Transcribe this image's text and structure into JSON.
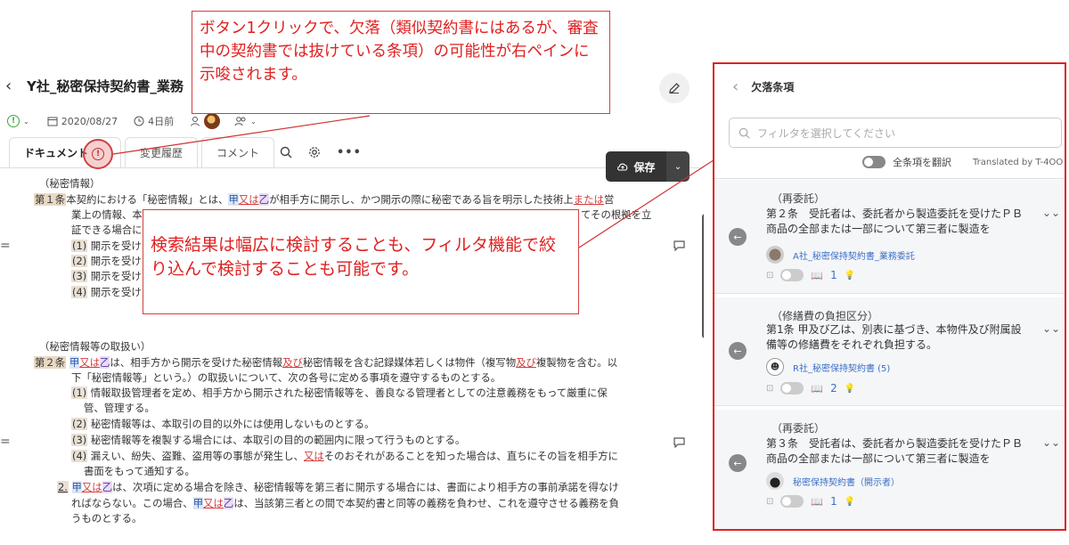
{
  "left": {
    "title": "Y社_秘密保持契約書_業務",
    "date": "2020/08/27",
    "relative_time": "4日前",
    "tabs": [
      "ドキュメント",
      "変更履歴",
      "コメント"
    ],
    "save_label": "保存",
    "doc_lines": {
      "h1": "（秘密情報）",
      "a1_num": "第１条",
      "a1_pre": "本契約における「秘密情報」とは、",
      "a1_kou": "甲",
      "a1_mata": "又は",
      "a1_otsu": "乙",
      "a1_post": "が相手方に開示し、かつ開示の際に秘密である旨を明示した技術上",
      "a1_mata2": "または",
      "a1_tail": "営",
      "a1_l2a": "業上の情報、本",
      "a1_l2b": "てその根拠を立",
      "a1_l3": "証できる場合に",
      "i1": "(1)",
      "i1_t": "開示を受け",
      "i2": "(2)",
      "i2_t": "開示を受け",
      "i3": "(3)",
      "i3_t": "開示を受け",
      "i4": "(4)",
      "i4_t": "開示を受け",
      "h2": "（秘密情報等の取扱い）",
      "a2_num": "第２条",
      "a2_kou": "甲",
      "a2_mata": "又は",
      "a2_otsu": "乙",
      "a2_mid": "は、相手方から開示を受けた秘密情報",
      "a2_oyobi": "及び",
      "a2_mid2": "秘密情報を含む記録媒体若しくは物件（複写物",
      "a2_oyobi2": "及び",
      "a2_tail": "複製物を含む。以",
      "a2_l2": "下「秘密情報等」という。）の取扱いについて、次の各号に定める事項を遵守するものとする。",
      "b1": "(1)",
      "b1_t": "情報取扱管理者を定め、相手方から開示された秘密情報等を、善良なる管理者としての注意義務をもって厳重に保",
      "b1_t2": "管、管理する。",
      "b2": "(2)",
      "b2_t": "秘密情報等は、本取引の目的以外には使用しないものとする。",
      "b3": "(3)",
      "b3_t": "秘密情報等を複製する場合には、本取引の目的の範囲内に限って行うものとする。",
      "b4": "(4)",
      "b4_pre": "漏えい、紛失、盗難、盗用等の事態が発生し、",
      "b4_mata": "又は",
      "b4_post": "そのおそれがあることを知った場合は、直ちにその旨を相手方に",
      "b4_t2": "書面をもって通知する。",
      "p2": "2.",
      "p2_kou": "甲",
      "p2_mata": "又は",
      "p2_otsu": "乙",
      "p2_post": "は、次項に定める場合を除き、秘密情報等を第三者に開示する場合には、書面により相手方の事前承諾を得なけ",
      "p2_l2a": "ればならない。この場合、",
      "p2_kou2": "甲",
      "p2_mata2": "又は",
      "p2_otsu2": "乙",
      "p2_l2b": "は、当該第三者との間で本契約書と同等の義務を負わせ、これを遵守させる義務を負",
      "p2_l3": "うものとする。"
    }
  },
  "callouts": {
    "c1": "ボタン1クリックで、欠落（類似契約書にはあるが、審査中の契約書では抜けている条項）の可能性が右ペインに示唆されます。",
    "c2": "検索結果は幅広に検討することも、フィルタ機能で絞り込んで検討することも可能です。"
  },
  "right": {
    "title": "欠落条項",
    "search_placeholder": "フィルタを選択してください",
    "translate_all": "全条項を翻訳",
    "translated_by": "Translated by T-4OO",
    "cards": [
      {
        "heading": "（再委託）",
        "body": "第２条　受託者は、委託者から製造委託を受けたＰＢ商品の全部または一部について第三者に製造を",
        "source": "A社_秘密保持契約書_業務委託",
        "count": "1"
      },
      {
        "heading": "（修繕費の負担区分）",
        "body": "第1条 甲及び乙は、別表に基づき、本物件及び附属設備等の修繕費をそれぞれ負担する。",
        "source": "R社_秘密保持契約書 (5)",
        "count": "2"
      },
      {
        "heading": "（再委託）",
        "body": "第３条　受託者は、委託者から製造委託を受けたＰＢ商品の全部または一部について第三者に製造を",
        "source": "秘密保持契約書（開示者）",
        "count": "1"
      }
    ]
  }
}
